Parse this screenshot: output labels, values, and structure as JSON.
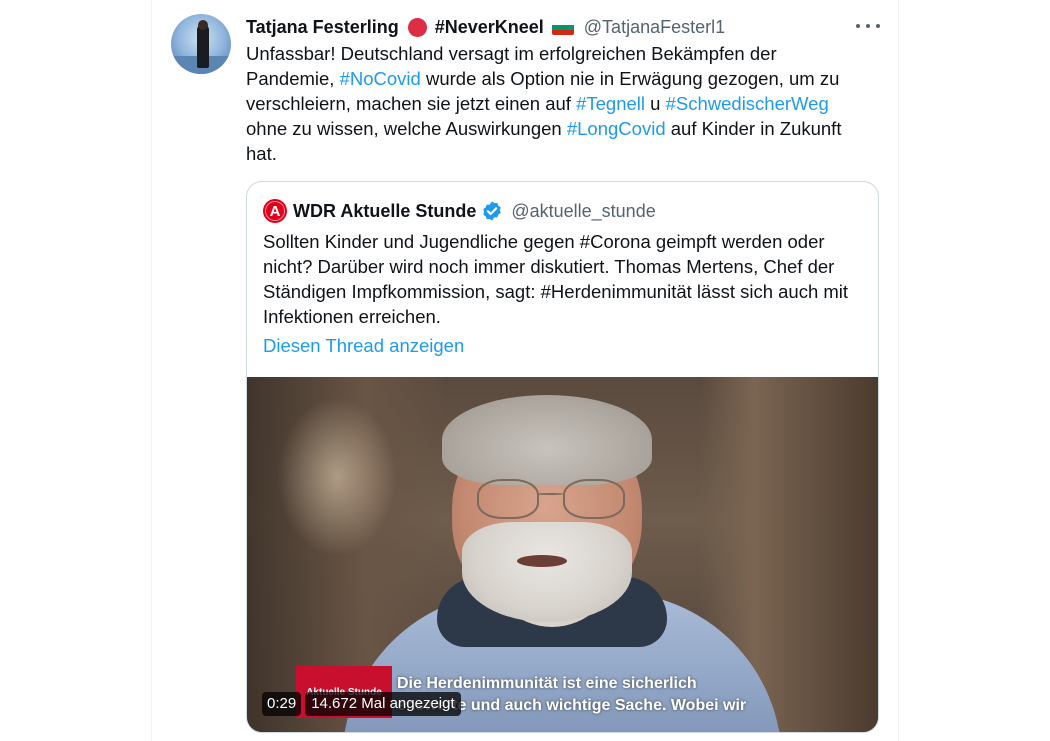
{
  "tweet": {
    "display_name": "Tatjana Festerling",
    "name_suffix": "#NeverKneel",
    "handle": "@TatjanaFesterl1",
    "text_segments": [
      {
        "text": "Unfassbar! Deutschland versagt im erfolgreichen Bekämpfen der Pandemie, ",
        "hashtag": false
      },
      {
        "text": "#NoCovid",
        "hashtag": true
      },
      {
        "text": " wurde als Option nie in Erwägung gezogen, um zu verschleiern, machen sie jetzt einen auf ",
        "hashtag": false
      },
      {
        "text": "#Tegnell",
        "hashtag": true
      },
      {
        "text": " u ",
        "hashtag": false
      },
      {
        "text": "#SchwedischerWeg",
        "hashtag": true
      },
      {
        "text": " ohne zu wissen, welche Auswirkungen ",
        "hashtag": false
      },
      {
        "text": "#LongCovid",
        "hashtag": true
      },
      {
        "text": " auf Kinder in Zukunft hat.",
        "hashtag": false
      }
    ],
    "icons": {
      "avatar": "avatar-image",
      "status_dot": "red-circle-emoji",
      "flag": "bulgaria-flag-emoji",
      "more": "more-options-icon"
    }
  },
  "quote": {
    "logo_letter": "A",
    "display_name": "WDR Aktuelle Stunde",
    "handle": "@aktuelle_stunde",
    "text": "Sollten Kinder und Jugendliche gegen #Corona geimpft werden oder nicht? Darüber wird noch immer diskutiert. Thomas Mertens, Chef der Ständigen Impfkommission, sagt: #Herdenimmunität lässt sich auch mit Infektionen erreichen.",
    "thread_link": "Diesen Thread anzeigen",
    "icons": {
      "logo": "wdr-logo-icon",
      "verified": "verified-badge-icon"
    }
  },
  "video": {
    "station_bug": "Aktuelle Stunde",
    "subtitle_line1": "Die Herdenimmunität ist eine sicherlich",
    "subtitle_line2": "enswerte und auch wichtige Sache. Wobei wir",
    "time": "0:29",
    "views": "14.672 Mal angezeigt"
  },
  "colors": {
    "hashtag": "#1d9bf0",
    "text": "#0f1419",
    "secondary": "#536471",
    "border": "#cfd9de",
    "status_red": "#dd2e44",
    "wdr_red": "#e2001a"
  }
}
